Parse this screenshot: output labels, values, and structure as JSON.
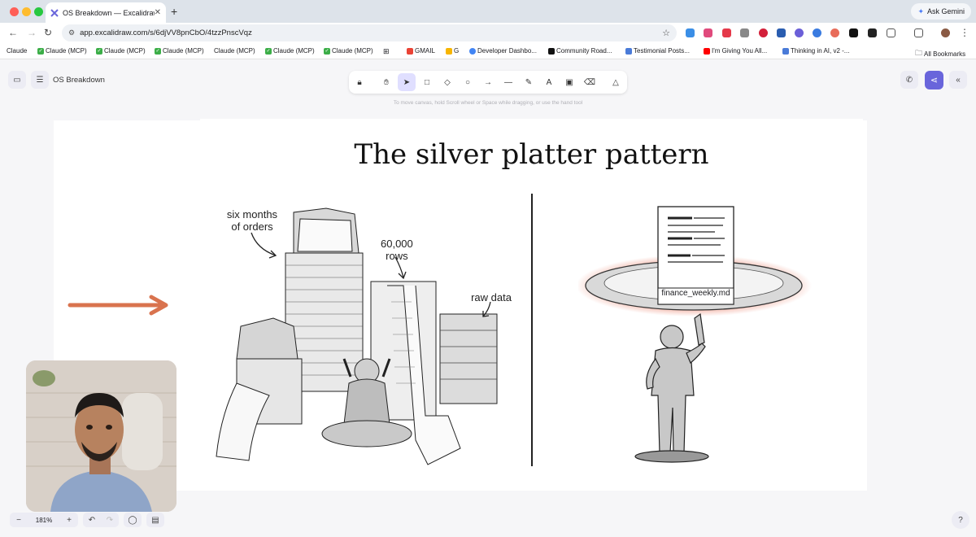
{
  "browser": {
    "tab_title": "OS Breakdown — Excalidraw",
    "new_tab_symbol": "+",
    "close_symbol": "✕",
    "ask_gemini": "Ask Gemini",
    "url": "app.excalidraw.com/s/6djVV8pnCbO/4tzzPnscVqz",
    "traffic_colors": [
      "#ff5f57",
      "#febc2e",
      "#28c840"
    ]
  },
  "bookmarks": [
    {
      "label": "Claude",
      "icon": "none"
    },
    {
      "label": "Claude (MCP)",
      "icon": "check-icon"
    },
    {
      "label": "Claude (MCP)",
      "icon": "check-icon"
    },
    {
      "label": "Claude (MCP)",
      "icon": "check-icon"
    },
    {
      "label": "Claude (MCP)",
      "icon": "none"
    },
    {
      "label": "Claude (MCP)",
      "icon": "check-icon"
    },
    {
      "label": "Claude (MCP)",
      "icon": "check-icon"
    },
    {
      "label": "GMAIL",
      "icon": "gmail-icon"
    },
    {
      "label": "G",
      "icon": "drive-icon"
    },
    {
      "label": "Developer Dashbo...",
      "icon": "google-icon"
    },
    {
      "label": "Community Road...",
      "icon": "tweet-icon"
    },
    {
      "label": "Testimonial Posts...",
      "icon": "doc-icon"
    },
    {
      "label": "I'm Giving You All...",
      "icon": "youtube-icon"
    },
    {
      "label": "Thinking in AI, v2 -...",
      "icon": "doc-icon"
    }
  ],
  "all_bookmarks": "All Bookmarks",
  "app": {
    "doc_name": "OS Breakdown",
    "hint": "To move canvas, hold Scroll wheel or Space while dragging, or use the hand tool",
    "zoom": "181%",
    "accent": "#6965db"
  },
  "slide": {
    "title": "The silver platter pattern",
    "annotations": {
      "six_months_line1": "six months",
      "six_months_line2": "of orders",
      "rows_line1": "60,000",
      "rows_line2": "rows",
      "raw_data": "raw data"
    },
    "document_label": "finance_weekly.md",
    "arrow_color": "#d9734e"
  }
}
